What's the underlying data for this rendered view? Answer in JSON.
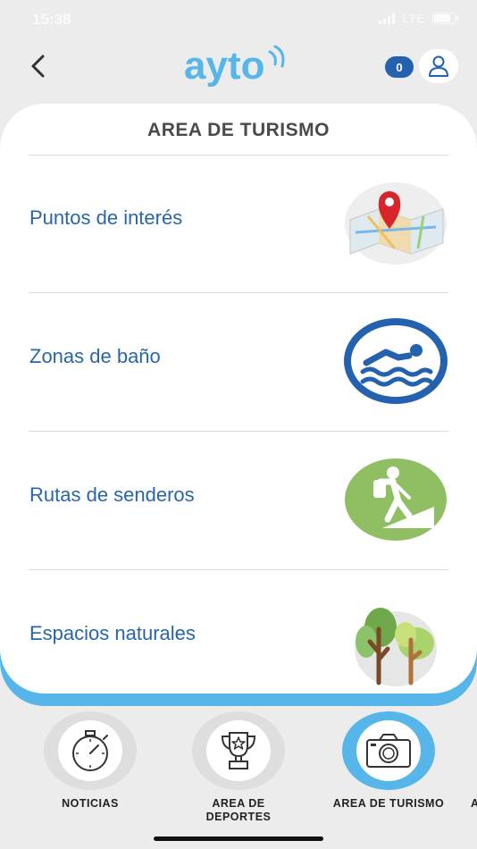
{
  "status_bar": {
    "time": "15:38",
    "network": "LTE"
  },
  "header": {
    "logo_text": "ayto",
    "notification_count": "0"
  },
  "section": {
    "title": "AREA DE TURISMO"
  },
  "items": [
    {
      "label": "Puntos de interés",
      "icon": "map-pin-icon"
    },
    {
      "label": "Zonas de baño",
      "icon": "swimmer-icon"
    },
    {
      "label": "Rutas de senderos",
      "icon": "hiker-icon"
    },
    {
      "label": "Espacios naturales",
      "icon": "trees-icon"
    }
  ],
  "bottom_nav": [
    {
      "label": "NOTICIAS",
      "icon": "stopwatch-icon",
      "active": false
    },
    {
      "label": "AREA DE DEPORTES",
      "icon": "trophy-icon",
      "active": false
    },
    {
      "label": "AREA DE TURISMO",
      "icon": "camera-icon",
      "active": true
    },
    {
      "label": "A",
      "icon": "",
      "active": false
    }
  ],
  "colors": {
    "accent": "#56b6ea",
    "link": "#2866a8",
    "badge": "#2462b0",
    "background": "#ececec",
    "swim_icon": "#2462b0",
    "hiker_icon": "#8fbf62"
  }
}
